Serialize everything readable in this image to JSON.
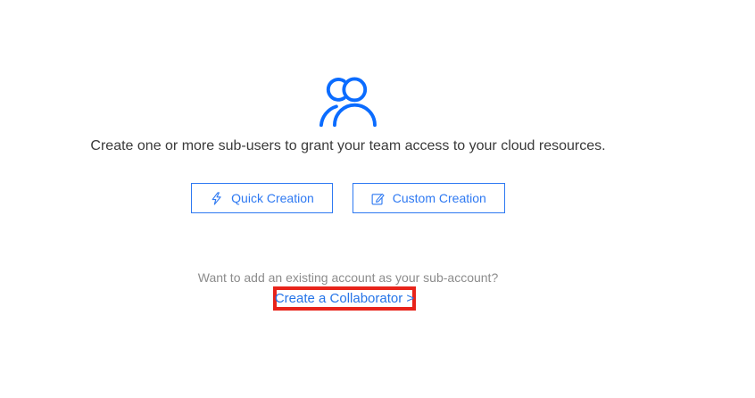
{
  "page": {
    "heading": "Create one or more sub-users to grant your team access to your cloud resources.",
    "question": "Want to add an existing account as your sub-account?",
    "collaborator_link": "Create a Collaborator >"
  },
  "buttons": [
    {
      "label": "Quick Creation",
      "icon": "lightning-icon"
    },
    {
      "label": "Custom Creation",
      "icon": "edit-icon"
    }
  ],
  "icons": {
    "header_icon": "users-icon"
  },
  "colors": {
    "accent_blue": "#0b6cff",
    "button_blue": "#2e79f2",
    "link_blue": "#2574e8",
    "heading_text": "#3a3a3a",
    "muted_text": "#8c8c8c",
    "annotation_red": "#e8231a"
  }
}
